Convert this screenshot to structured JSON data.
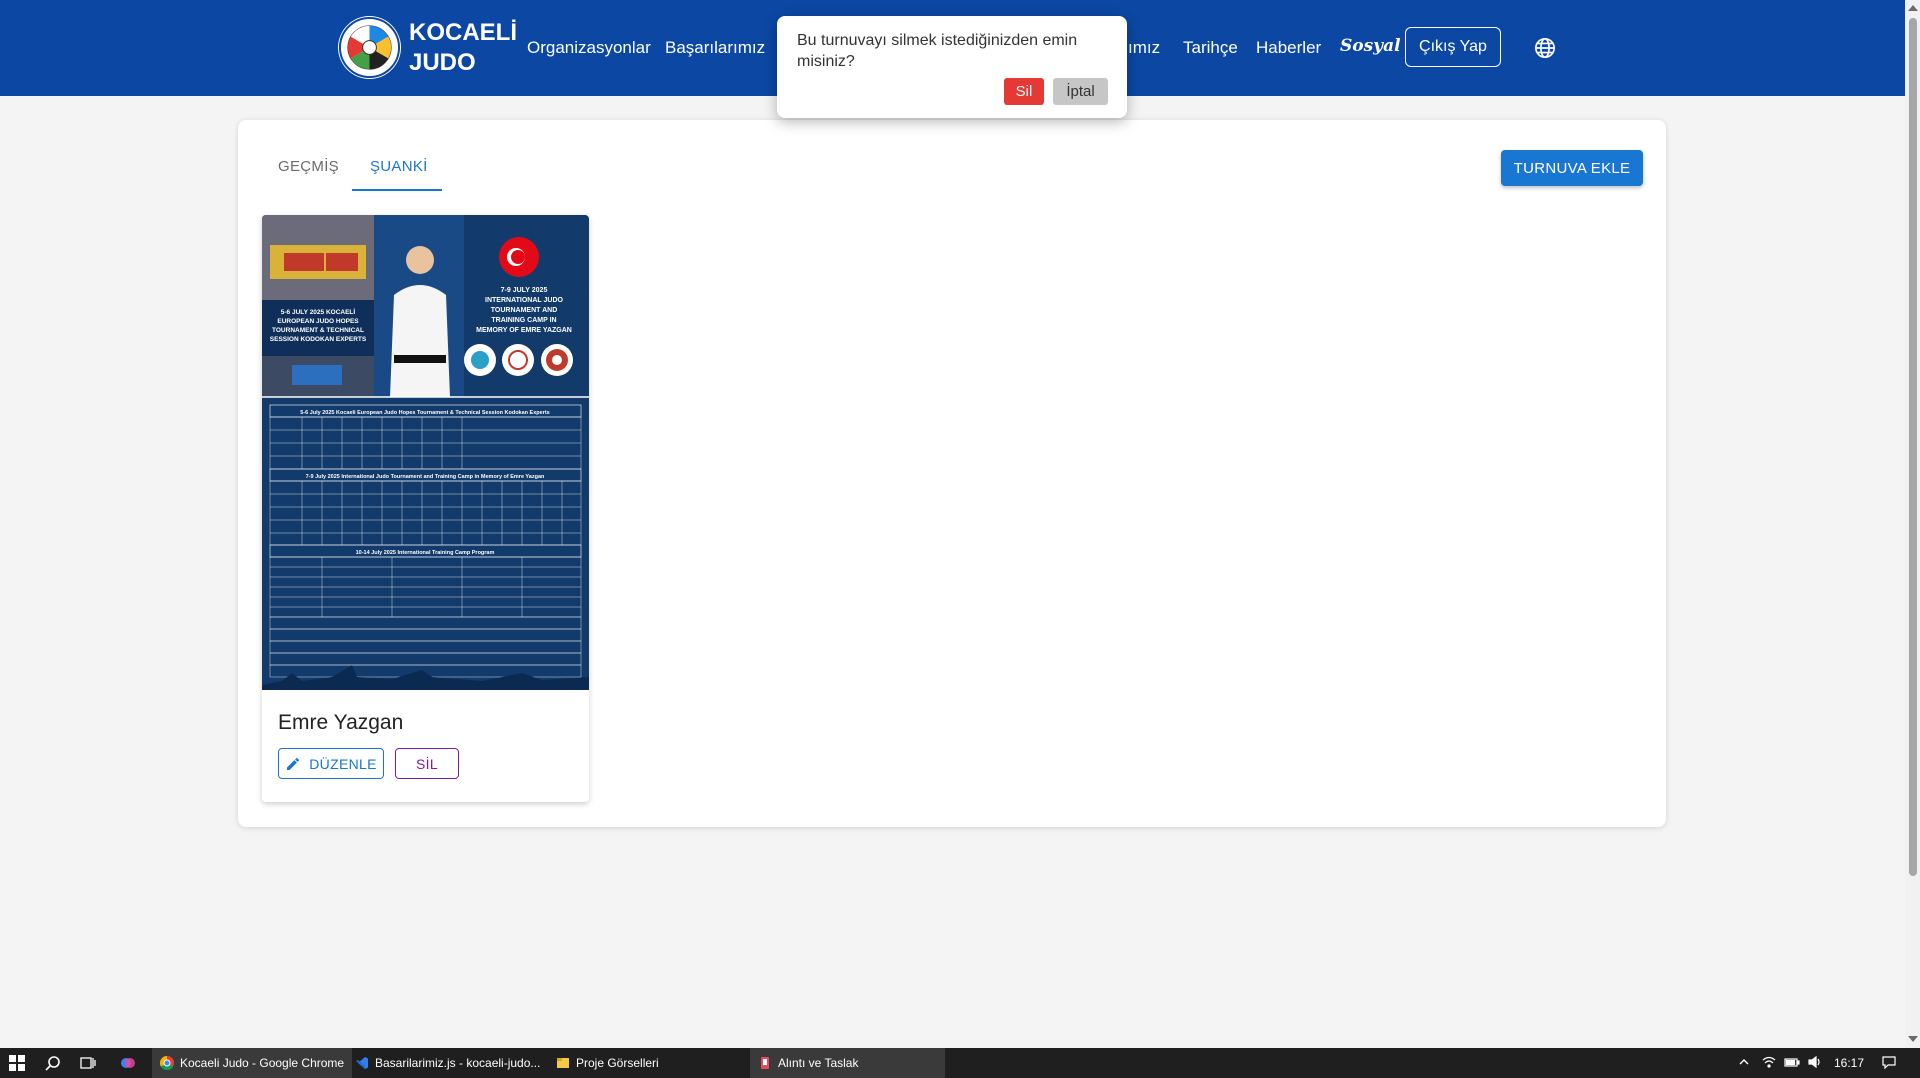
{
  "brand": {
    "line1": "KOCAELİ",
    "line2": "JUDO"
  },
  "nav": {
    "items": [
      "Organizasyonlar",
      "Başarılarımız",
      "ımız",
      "Tarihçe",
      "Haberler"
    ],
    "social": "Sosyal",
    "logout": "Çıkış Yap",
    "globe_icon": "globe-icon"
  },
  "confirm": {
    "message": "Bu turnuvayı silmek istediğinizden emin misiniz?",
    "yes": "Sil",
    "no": "İptal"
  },
  "tabs": {
    "past": "GEÇMİŞ",
    "current": "ŞUANKİ"
  },
  "add_button": "TURNUVA EKLE",
  "card": {
    "title": "Emre Yazgan",
    "edit": "DÜZENLE",
    "delete": "SİL",
    "poster": {
      "left_block": "5-6 JULY 2025 KOCAELİ EUROPEAN JUDO HOPES TOURNAMENT & TECHNICAL SESSION KODOKAN EXPERTS",
      "right_block": "7-9 JULY 2025 INTERNATIONAL JUDO TOURNAMENT AND TRAINING CAMP IN MEMORY OF EMRE YAZGAN",
      "row1": "5-6 July 2025 Kocaeli European Judo Hopes Tournament & Technical Session Kodokan Experts",
      "row2": "7-9 July 2025 International Judo Tournament and Training Camp in Memory of Emre Yazgan",
      "row3": "10-14 July 2025 International Training Camp Program"
    }
  },
  "taskbar": {
    "apps": [
      "Kocaeli Judo - Google Chrome",
      "Basarilarimiz.js - kocaeli-judo...",
      "Proje Görselleri",
      "Alıntı ve Taslak"
    ],
    "time": "16:17"
  },
  "colors": {
    "nav": "#0b47a3",
    "primary": "#1976d2",
    "danger": "#e53935",
    "purple": "#7b1fa2",
    "poster": "#123a6b"
  }
}
